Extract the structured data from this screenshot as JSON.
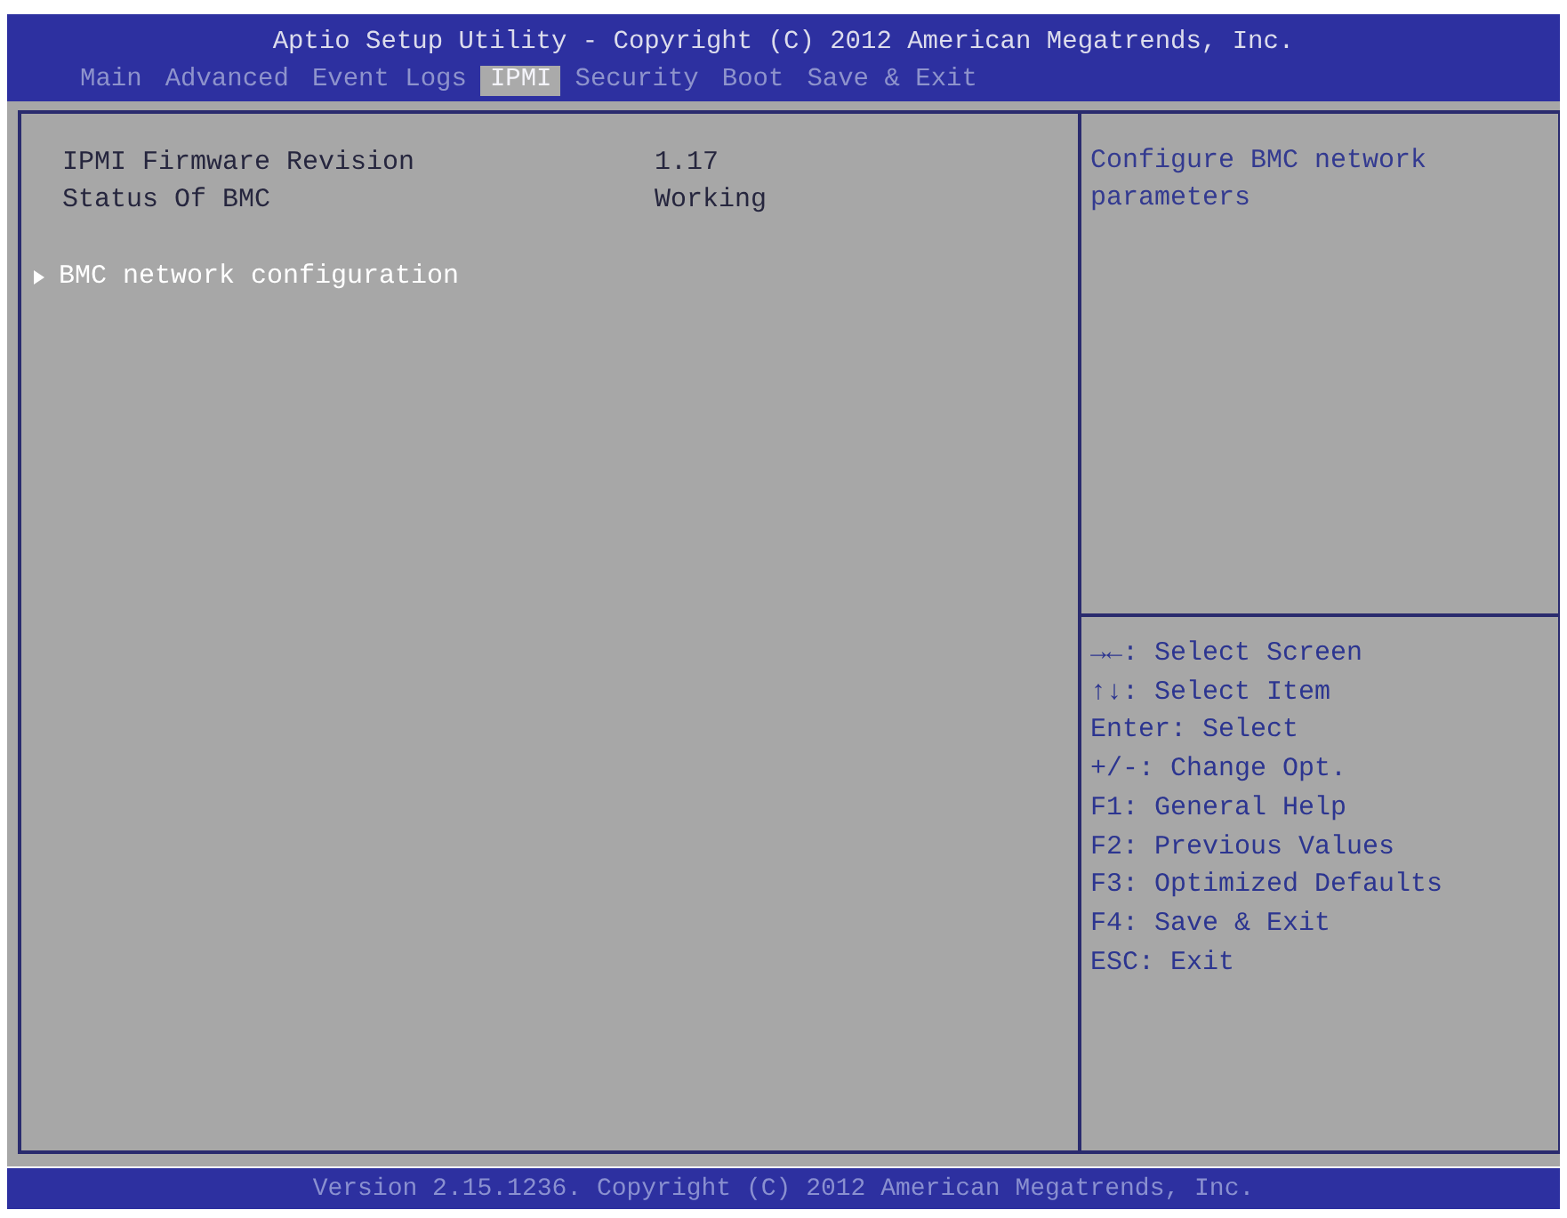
{
  "window": {
    "title": "Aptio Setup Utility - Copyright (C) 2012 American Megatrends, Inc."
  },
  "tabs": [
    {
      "label": "Main",
      "selected": false
    },
    {
      "label": "Advanced",
      "selected": false
    },
    {
      "label": "Event Logs",
      "selected": false
    },
    {
      "label": "IPMI",
      "selected": true
    },
    {
      "label": "Security",
      "selected": false
    },
    {
      "label": "Boot",
      "selected": false
    },
    {
      "label": "Save & Exit",
      "selected": false
    }
  ],
  "info": [
    {
      "label": "IPMI Firmware Revision",
      "value": "1.17"
    },
    {
      "label": "Status Of BMC",
      "value": "Working"
    }
  ],
  "submenus": [
    {
      "label": "BMC network configuration",
      "selected": true
    }
  ],
  "help_text": "Configure BMC network parameters",
  "key_help": [
    "→←: Select Screen",
    "↑↓: Select Item",
    "Enter: Select",
    "+/-: Change Opt.",
    "F1: General Help",
    "F2: Previous Values",
    "F3: Optimized Defaults",
    "F4: Save & Exit",
    "ESC: Exit"
  ],
  "status_bar": "Version 2.15.1236. Copyright (C) 2012 American Megatrends, Inc."
}
